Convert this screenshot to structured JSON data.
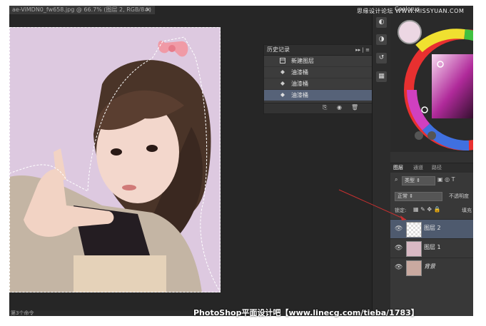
{
  "document": {
    "tab_title": "ae-ViMDN0_fw658.jpg @ 66.7% (图层 2, RGB/8#)",
    "status": "第3个命令"
  },
  "history_panel": {
    "title": "历史记录",
    "items": [
      {
        "label": "新建图层",
        "icon": "new-layer-icon"
      },
      {
        "label": "油漆桶",
        "icon": "paint-bucket-icon"
      },
      {
        "label": "油漆桶",
        "icon": "paint-bucket-icon"
      },
      {
        "label": "油漆桶",
        "icon": "paint-bucket-icon",
        "selected": true
      }
    ]
  },
  "color_panel": {
    "title": "Coolorus",
    "swatch_color": "#ecd7e3"
  },
  "layers_panel": {
    "tabs": [
      "图层",
      "通道",
      "路径"
    ],
    "filter_label": "类型",
    "blend_mode": "正常",
    "opacity_label": "不透明度",
    "lock_label": "锁定:",
    "fill_label": "填充",
    "layers": [
      {
        "name": "图层 2",
        "selected": true
      },
      {
        "name": "图层 1",
        "selected": false
      },
      {
        "name": "背景",
        "selected": false
      }
    ]
  },
  "watermarks": {
    "top": "思缘设计论坛 WWW.MISSYUAN.COM",
    "bottom": "PhotoShop平面设计吧【www.linecg.com/tieba/1783】"
  },
  "colors": {
    "canvas_bg": "#ddc9e0",
    "workspace": "#262626",
    "selection_highlight": "#566278"
  }
}
